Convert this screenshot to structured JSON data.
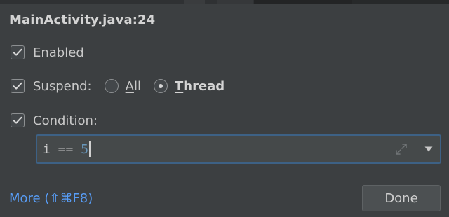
{
  "popup": {
    "title": "MainActivity.java:24"
  },
  "options": {
    "enabled_label": "Enabled",
    "enabled_checked": true,
    "suspend_label": "Suspend:",
    "suspend_checked": true,
    "suspend_choices": [
      {
        "label_access": "A",
        "label_rest": "ll",
        "selected": false
      },
      {
        "label_access": "T",
        "label_rest": "hread",
        "selected": true
      }
    ],
    "condition_label": "Condition:",
    "condition_checked": true
  },
  "condition": {
    "code_prefix": "i == ",
    "code_number": "5"
  },
  "footer": {
    "more_label": "More (⇧⌘F8)",
    "done_label": "Done"
  },
  "colors": {
    "link": "#589df6",
    "field_focus_border": "#3d6185",
    "number_literal": "#6897bb"
  }
}
